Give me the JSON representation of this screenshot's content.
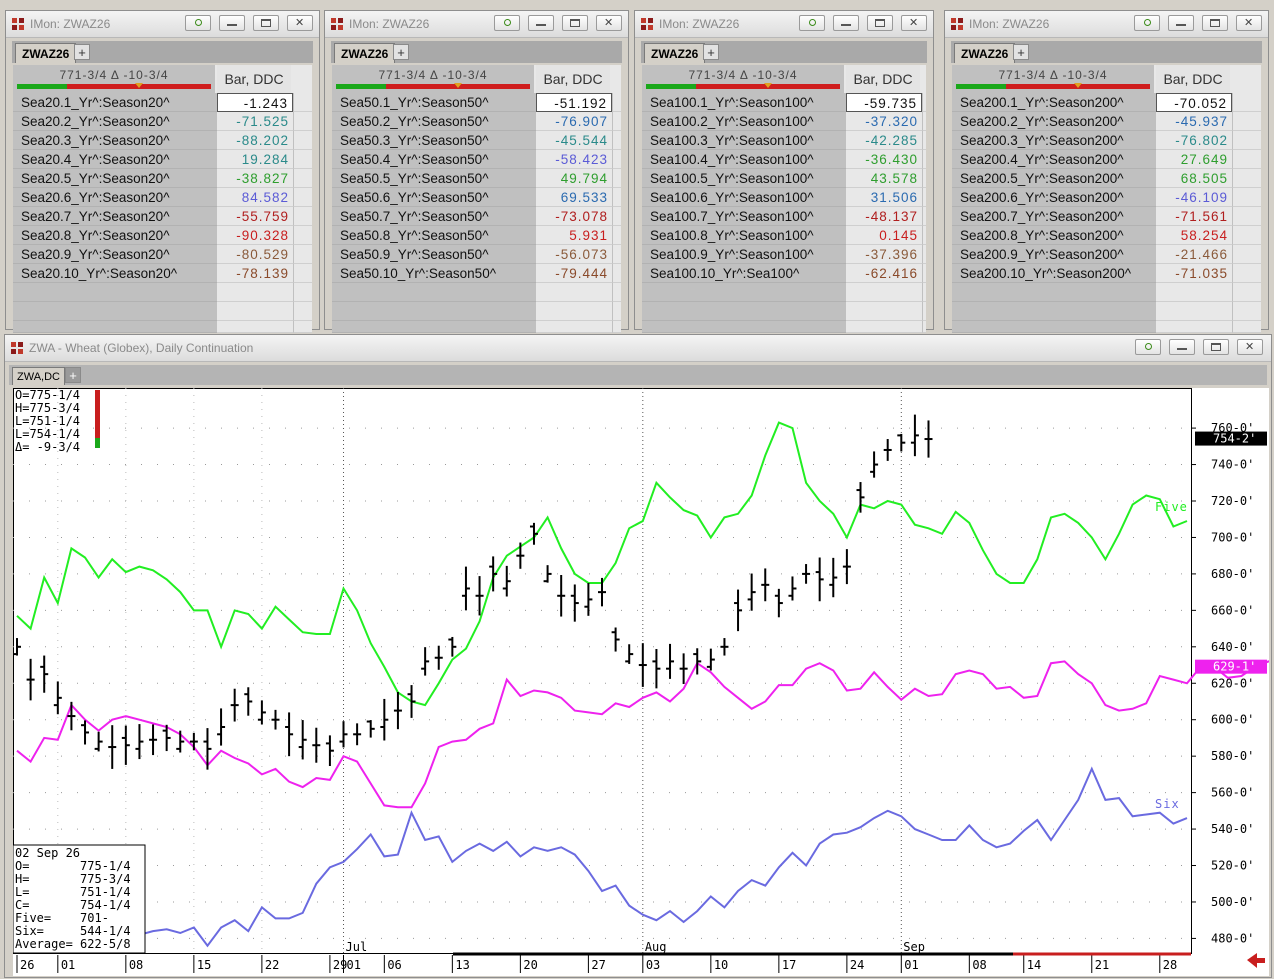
{
  "panels": [
    {
      "window_title": "IMon: ZWAZ26",
      "tab_label": "ZWAZ26",
      "header_symbol": "771-3/4 Δ -10-3/4",
      "header_col": "Bar, DDC",
      "rows": [
        {
          "sym": "Sea20.1_Yr^:Season20^",
          "val": "-1.243",
          "color": "#111111"
        },
        {
          "sym": "Sea20.2_Yr^:Season20^",
          "val": "-71.525",
          "color": "#2a8a8a"
        },
        {
          "sym": "Sea20.3_Yr^:Season20^",
          "val": "-88.202",
          "color": "#2a8a8a"
        },
        {
          "sym": "Sea20.4_Yr^:Season20^",
          "val": "19.284",
          "color": "#2a8a8a"
        },
        {
          "sym": "Sea20.5_Yr^:Season20^",
          "val": "-38.827",
          "color": "#2e9e2e"
        },
        {
          "sym": "Sea20.6_Yr^:Season20^",
          "val": "84.582",
          "color": "#5b5bd6"
        },
        {
          "sym": "Sea20.7_Yr^:Season20^",
          "val": "-55.759",
          "color": "#b01e1e"
        },
        {
          "sym": "Sea20.8_Yr^:Season20^",
          "val": "-90.328",
          "color": "#c81e1e"
        },
        {
          "sym": "Sea20.9_Yr^:Season20^",
          "val": "-80.529",
          "color": "#8a5a3a"
        },
        {
          "sym": "Sea20.10_Yr^:Season20^",
          "val": "-78.139",
          "color": "#8a4a2a"
        }
      ]
    },
    {
      "window_title": "IMon: ZWAZ26",
      "tab_label": "ZWAZ26",
      "header_symbol": "771-3/4 Δ -10-3/4",
      "header_col": "Bar, DDC",
      "rows": [
        {
          "sym": "Sea50.1_Yr^:Season50^",
          "val": "-51.192",
          "color": "#111111"
        },
        {
          "sym": "Sea50.2_Yr^:Season50^",
          "val": "-76.907",
          "color": "#2a6ab0"
        },
        {
          "sym": "Sea50.3_Yr^:Season50^",
          "val": "-45.544",
          "color": "#2a8a8a"
        },
        {
          "sym": "Sea50.4_Yr^:Season50^",
          "val": "-58.423",
          "color": "#5b5bd6"
        },
        {
          "sym": "Sea50.5_Yr^:Season50^",
          "val": "49.794",
          "color": "#2e9e2e"
        },
        {
          "sym": "Sea50.6_Yr^:Season50^",
          "val": "69.533",
          "color": "#2a6ab0"
        },
        {
          "sym": "Sea50.7_Yr^:Season50^",
          "val": "-73.078",
          "color": "#b01e1e"
        },
        {
          "sym": "Sea50.8_Yr^:Season50^",
          "val": "5.931",
          "color": "#c81e1e"
        },
        {
          "sym": "Sea50.9_Yr^:Season50^",
          "val": "-56.073",
          "color": "#8a5a3a"
        },
        {
          "sym": "Sea50.10_Yr^:Season50^",
          "val": "-79.444",
          "color": "#8a4a2a"
        }
      ]
    },
    {
      "window_title": "IMon: ZWAZ26",
      "tab_label": "ZWAZ26",
      "header_symbol": "771-3/4 Δ -10-3/4",
      "header_col": "Bar, DDC",
      "rows": [
        {
          "sym": "Sea100.1_Yr^:Season100^",
          "val": "-59.735",
          "color": "#111111"
        },
        {
          "sym": "Sea100.2_Yr^:Season100^",
          "val": "-37.320",
          "color": "#2a6ab0"
        },
        {
          "sym": "Sea100.3_Yr^:Season100^",
          "val": "-42.285",
          "color": "#2a8a8a"
        },
        {
          "sym": "Sea100.4_Yr^:Season100^",
          "val": "-36.430",
          "color": "#2e9e2e"
        },
        {
          "sym": "Sea100.5_Yr^:Season100^",
          "val": "43.578",
          "color": "#2e9e2e"
        },
        {
          "sym": "Sea100.6_Yr^:Season100^",
          "val": "31.506",
          "color": "#2a6ab0"
        },
        {
          "sym": "Sea100.7_Yr^:Season100^",
          "val": "-48.137",
          "color": "#b01e1e"
        },
        {
          "sym": "Sea100.8_Yr^:Season100^",
          "val": "0.145",
          "color": "#c81e1e"
        },
        {
          "sym": "Sea100.9_Yr^:Season100^",
          "val": "-37.396",
          "color": "#8a5a3a"
        },
        {
          "sym": "Sea100.10_Yr^:Sea100^",
          "val": "-62.416",
          "color": "#8a4a2a"
        }
      ]
    },
    {
      "window_title": "IMon: ZWAZ26",
      "tab_label": "ZWAZ26",
      "header_symbol": "771-3/4 Δ -10-3/4",
      "header_col": "Bar, DDC",
      "rows": [
        {
          "sym": "Sea200.1_Yr^:Season200^",
          "val": "-70.052",
          "color": "#111111"
        },
        {
          "sym": "Sea200.2_Yr^:Season200^",
          "val": "-45.937",
          "color": "#2a6ab0"
        },
        {
          "sym": "Sea200.3_Yr^:Season200^",
          "val": "-76.802",
          "color": "#2a8a8a"
        },
        {
          "sym": "Sea200.4_Yr^:Season200^",
          "val": "27.649",
          "color": "#2e9e2e"
        },
        {
          "sym": "Sea200.5_Yr^:Season200^",
          "val": "68.505",
          "color": "#2e9e2e"
        },
        {
          "sym": "Sea200.6_Yr^:Season200^",
          "val": "-46.109",
          "color": "#5b5bd6"
        },
        {
          "sym": "Sea200.7_Yr^:Season200^",
          "val": "-71.561",
          "color": "#b01e1e"
        },
        {
          "sym": "Sea200.8_Yr^:Season200^",
          "val": "58.254",
          "color": "#c81e1e"
        },
        {
          "sym": "Sea200.9_Yr^:Season200^",
          "val": "-21.466",
          "color": "#8a5a3a"
        },
        {
          "sym": "Sea200.10_Yr^:Season200^",
          "val": "-71.035",
          "color": "#8a4a2a"
        }
      ]
    }
  ],
  "chart_window": {
    "title": "ZWA - Wheat (Globex), Daily Continuation",
    "tab_label": "ZWA,DC",
    "tab_plus": "+"
  },
  "chart_data": {
    "type": "line",
    "title": "",
    "price_axis": {
      "ticks": [
        "760-0'",
        "740-0'",
        "720-0'",
        "700-0'",
        "680-0'",
        "660-0'",
        "640-0'",
        "620-0'",
        "600-0'",
        "580-0'",
        "560-0'",
        "540-0'",
        "520-0'",
        "500-0'",
        "480-0'"
      ],
      "ylim": [
        472,
        782
      ],
      "last_price_label": "754-2'",
      "average_label": "629-1'"
    },
    "x_labels": [
      "26",
      "01",
      "08",
      "15",
      "22",
      "29",
      "01",
      "06",
      "13",
      "20",
      "27",
      "03",
      "10",
      "17",
      "24",
      "01",
      "08",
      "14",
      "21",
      "28"
    ],
    "month_labels": [
      "Jul",
      "Aug",
      "Sep"
    ],
    "top_left_info": [
      "O=775-1/4",
      "H=775-3/4",
      "L=751-1/4",
      "L=754-1/4",
      "Δ= -9-3/4"
    ],
    "data_box": [
      "02 Sep 26",
      "O=       775-1/4",
      "H=       775-3/4",
      "L=       751-1/4",
      "C=       754-1/4",
      "Five=    701-",
      "Six=     544-1/4",
      "Average= 622-5/8"
    ],
    "series": [
      {
        "name": "Five",
        "color": "#22ee22",
        "values": [
          657,
          650,
          678,
          664,
          694,
          689,
          678,
          688,
          681,
          684,
          682,
          677,
          670,
          660,
          660,
          640,
          660,
          658,
          650,
          662,
          655,
          648,
          647,
          647,
          672,
          660,
          642,
          629,
          615,
          610,
          608,
          620,
          633,
          639,
          654,
          678,
          690,
          695,
          700,
          711,
          694,
          680,
          675,
          675,
          686,
          705,
          709,
          730,
          722,
          715,
          712,
          700,
          711,
          713,
          723,
          745,
          763,
          760,
          730,
          720,
          713,
          700,
          718,
          716,
          720,
          718,
          707,
          705,
          702,
          714,
          708,
          693,
          680,
          675,
          675,
          688,
          711,
          713,
          708,
          700,
          688,
          702,
          718,
          723,
          721,
          706,
          709
        ]
      },
      {
        "name": "Average",
        "color": "#ee22ee",
        "values": [
          583,
          577,
          590,
          589,
          608,
          600,
          594,
          600,
          602,
          600,
          598,
          596,
          592,
          585,
          575,
          583,
          579,
          576,
          570,
          573,
          566,
          563,
          568,
          567,
          580,
          577,
          565,
          553,
          552,
          552,
          565,
          585,
          588,
          589,
          595,
          598,
          622,
          613,
          616,
          615,
          612,
          605,
          604,
          603,
          609,
          607,
          612,
          615,
          610,
          617,
          631,
          626,
          618,
          612,
          606,
          610,
          619,
          619,
          628,
          631,
          627,
          616,
          617,
          626,
          618,
          611,
          617,
          613,
          614,
          625,
          627,
          625,
          617,
          618,
          612,
          613,
          631,
          632,
          625,
          620,
          608,
          605,
          606,
          609,
          624,
          622,
          620,
          629,
          629,
          623,
          624,
          629,
          632,
          633,
          634,
          627,
          626
        ]
      },
      {
        "name": "Six",
        "color": "#6a6ae0",
        "values": [
          514,
          509,
          502,
          505,
          499,
          502,
          504,
          496,
          488,
          482,
          484,
          485,
          483,
          486,
          476,
          486,
          490,
          484,
          497,
          491,
          491,
          494,
          510,
          519,
          522,
          529,
          537,
          525,
          526,
          549,
          534,
          536,
          522,
          528,
          532,
          528,
          533,
          525,
          530,
          528,
          530,
          526,
          517,
          506,
          509,
          498,
          493,
          490,
          495,
          489,
          495,
          503,
          497,
          506,
          512,
          509,
          519,
          527,
          520,
          532,
          537,
          538,
          541,
          546,
          550,
          547,
          540,
          537,
          534,
          534,
          542,
          534,
          530,
          532,
          539,
          545,
          534,
          545,
          556,
          573,
          556,
          557,
          547,
          548,
          549,
          543,
          546
        ]
      }
    ]
  }
}
